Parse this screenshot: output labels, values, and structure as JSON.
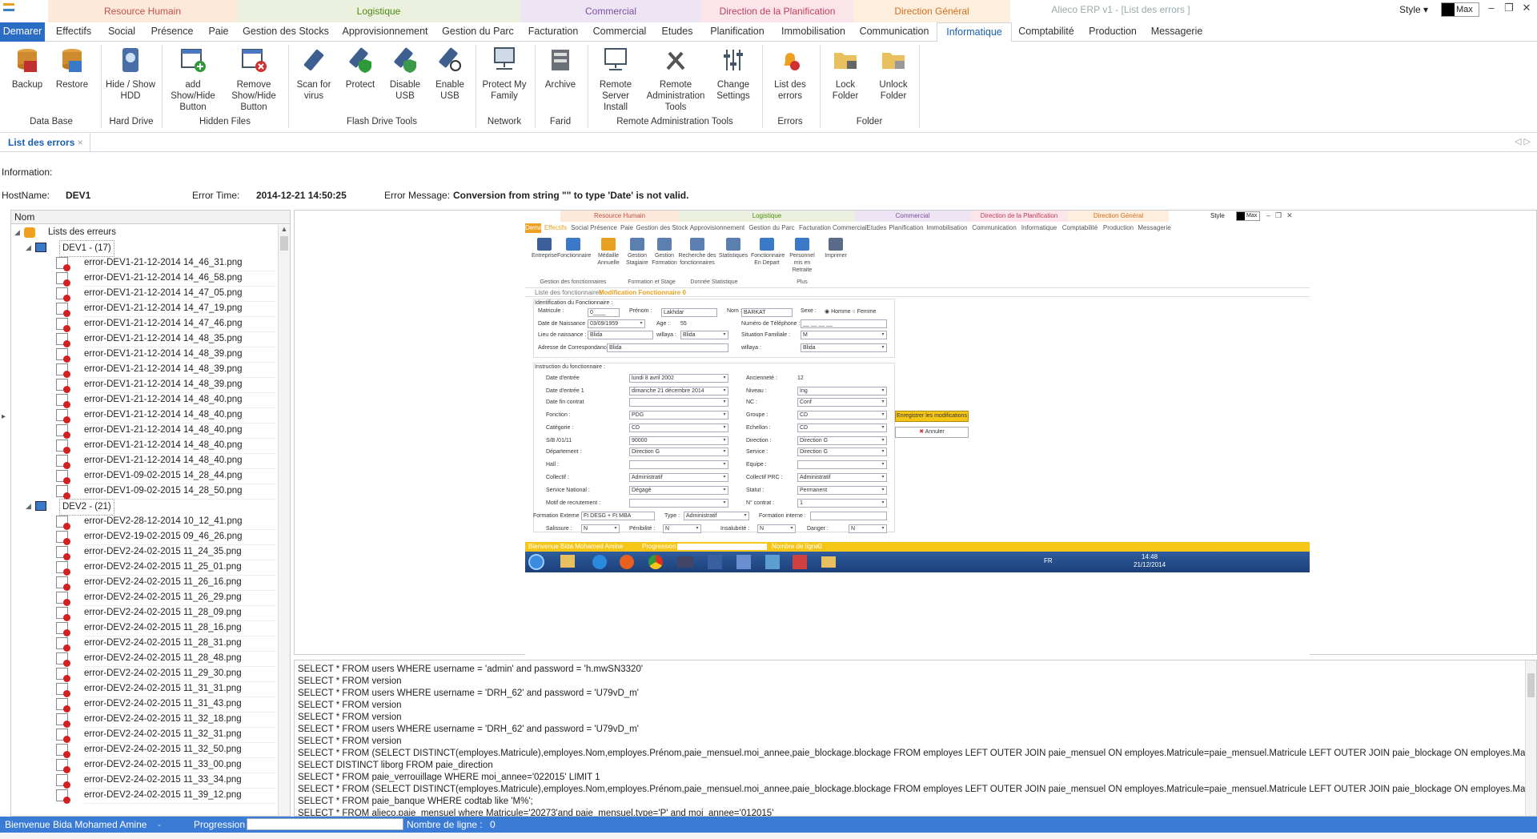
{
  "app": {
    "window_title": "Alieco ERP v1 - [List des errors ]",
    "style_label": "Style",
    "max_label": "Max"
  },
  "groups": [
    {
      "label": "Resource Humain",
      "color": "#fde9d9",
      "text": "#c0504d"
    },
    {
      "label": "Logistique",
      "color": "#ebf1de",
      "text": "#4f8a10"
    },
    {
      "label": "Commercial",
      "color": "#ede4f4",
      "text": "#7f4fa0"
    },
    {
      "label": "Direction de la Planification",
      "color": "#fbe4ea",
      "text": "#c0405a"
    },
    {
      "label": "Direction Général",
      "color": "#fdeede",
      "text": "#d07020"
    }
  ],
  "tabs": [
    "Demarer",
    "Effectifs",
    "Social",
    "Présence",
    "Paie",
    "Gestion des Stocks",
    "Approvisionnement",
    "Gestion du Parc",
    "Facturation",
    "Commercial",
    "Etudes",
    "Planification",
    "Immobilisation",
    "Communication",
    "Informatique",
    "Comptabilité",
    "Production",
    "Messagerie"
  ],
  "ribbon": {
    "buttons": [
      "Backup",
      "Restore",
      "Hide / Show HDD",
      "add Show/Hide Button",
      "Remove Show/Hide Button",
      "Scan for virus",
      "Protect",
      "Disable USB",
      "Enable USB",
      "Protect My Family",
      "Archive",
      "Remote Server Install",
      "Remote Administration Tools",
      "Change Settings",
      "List des errors",
      "Lock Folder",
      "Unlock Folder"
    ],
    "groups": [
      "Data Base",
      "Hard Drive",
      "Hidden Files",
      "Flash Drive Tools",
      "Network",
      "Farid",
      "Remote Administration Tools",
      "Errors",
      "Folder"
    ]
  },
  "doc_tab": "List des errors",
  "info": {
    "heading": "Information:",
    "host_label": "HostName:",
    "host": "DEV1",
    "time_label": "Error Time:",
    "time": "2014-12-21 14:50:25",
    "msg_label": "Error Message:",
    "msg": "Conversion from string \"\" to type 'Date' is not valid."
  },
  "tree": {
    "header": "Nom",
    "root": "Lists des erreurs",
    "dev1": {
      "label": "DEV1 - (17)",
      "files": [
        "error-DEV1-21-12-2014 14_46_31.png",
        "error-DEV1-21-12-2014 14_46_58.png",
        "error-DEV1-21-12-2014 14_47_05.png",
        "error-DEV1-21-12-2014 14_47_19.png",
        "error-DEV1-21-12-2014 14_47_46.png",
        "error-DEV1-21-12-2014 14_48_35.png",
        "error-DEV1-21-12-2014 14_48_39.png",
        "error-DEV1-21-12-2014 14_48_39.png",
        "error-DEV1-21-12-2014 14_48_39.png",
        "error-DEV1-21-12-2014 14_48_40.png",
        "error-DEV1-21-12-2014 14_48_40.png",
        "error-DEV1-21-12-2014 14_48_40.png",
        "error-DEV1-21-12-2014 14_48_40.png",
        "error-DEV1-21-12-2014 14_48_40.png",
        "error-DEV1-09-02-2015 14_28_44.png",
        "error-DEV1-09-02-2015 14_28_50.png"
      ]
    },
    "dev2": {
      "label": "DEV2 - (21)",
      "files": [
        "error-DEV2-28-12-2014 10_12_41.png",
        "error-DEV2-19-02-2015 09_46_26.png",
        "error-DEV2-24-02-2015 11_24_35.png",
        "error-DEV2-24-02-2015 11_25_01.png",
        "error-DEV2-24-02-2015 11_26_16.png",
        "error-DEV2-24-02-2015 11_26_29.png",
        "error-DEV2-24-02-2015 11_28_09.png",
        "error-DEV2-24-02-2015 11_28_16.png",
        "error-DEV2-24-02-2015 11_28_31.png",
        "error-DEV2-24-02-2015 11_28_48.png",
        "error-DEV2-24-02-2015 11_29_30.png",
        "error-DEV2-24-02-2015 11_31_31.png",
        "error-DEV2-24-02-2015 11_31_43.png",
        "error-DEV2-24-02-2015 11_32_18.png",
        "error-DEV2-24-02-2015 11_32_31.png",
        "error-DEV2-24-02-2015 11_32_50.png",
        "error-DEV2-24-02-2015 11_33_00.png",
        "error-DEV2-24-02-2015 11_33_34.png",
        "error-DEV2-24-02-2015 11_39_12.png"
      ]
    }
  },
  "preview": {
    "groups": [
      "Resource Humain",
      "Logistique",
      "Commercial",
      "Direction de la Planification",
      "Direction Général"
    ],
    "tabs": [
      "Demarer",
      "Effectifs",
      "Social",
      "Présence",
      "Paie",
      "Gestion des Stock",
      "Approvisionnement",
      "Gestion du Parc",
      "Facturation",
      "Commercial",
      "Etudes",
      "Planification",
      "Immobilisation",
      "Communication",
      "Informatique",
      "Comptabilité",
      "Production",
      "Messagerie"
    ],
    "ribbon": [
      "Entreprise",
      "Fonctionnaire",
      "Médaille Annuelle",
      "Gestion Stagiaire",
      "Gestion Formation",
      "Recherche des fonctionnaires",
      "Statistiques",
      "Fonctionnaire En Depart",
      "Personnel mis en Retraite",
      "Imprimer"
    ],
    "ribbon_groups": [
      "Gestion des fonctionnaires",
      "Formation et Stage",
      "Donnée Statistique",
      "Plus"
    ],
    "doctabs": [
      "Liste des fonctionnaires",
      "Modification Fonctionnaire 0"
    ],
    "sec1": "Identification du Fonctionnaire :",
    "sec2": "Instruction du fonctionnaire :",
    "fields": {
      "matricule": "Matricule :",
      "matricule_v": "0____",
      "prenom": "Prénom :",
      "prenom_v": "Lakhdar",
      "nom": "Nom :",
      "nom_v": "BARKAT",
      "sexe": "Sexe :",
      "homme": "Homme",
      "femme": "Femme",
      "dn": "Date de Naissance :",
      "dn_v": "03/09/1959",
      "age": "Age :",
      "age_v": "55",
      "tel": "Numéro de Téléphone :",
      "tel_v": "__ __ __ __",
      "ln": "Lieu de naissance :",
      "ln_v": "Blida",
      "wil": "willaya :",
      "wil_v": "Blida",
      "sf": "Situation Familiale :",
      "sf_v": "M",
      "adr": "Adresse de Correspondance :",
      "adr_v": "Blida",
      "wil2": "willaya :",
      "wil2_v": "Blida",
      "de": "Date d'entrée",
      "de_v": "lundi 8 avril 2002",
      "anc": "Ancienneté :",
      "anc_v": "12",
      "de1": "Date d'entrée 1",
      "de1_v": "dimanche 21 décembre 2014",
      "niv": "Niveau :",
      "niv_v": "Ing",
      "dfc": "Date fin contrat",
      "nc": "NC :",
      "nc_v": "Conf",
      "fct": "Fonction :",
      "fct_v": "PDG",
      "grp": "Groupe :",
      "grp_v": "CD",
      "cat": "Catégorie :",
      "cat_v": "CD",
      "ech": "Echellon :",
      "ech_v": "CD",
      "sb": "S/B /01/11",
      "sb_v": "90000",
      "dir": "Direction :",
      "dir_v": "Direction G",
      "dep": "Département :",
      "dep_v": "Direction G",
      "srv": "Service :",
      "srv_v": "Direction G",
      "hall": "Hall :",
      "eq": "Equipe :",
      "col": "Collectif :",
      "col_v": "Administratif",
      "colprc": "Collectif PRC :",
      "colprc_v": "Administratif",
      "sn": "Service National :",
      "sn_v": "Dégagé",
      "stat": "Statut :",
      "stat_v": "Permanent",
      "motif": "Motif de recrutement :",
      "ncontrat": "N° contrat :",
      "ncontrat_v": "1",
      "fext": "Formation Externe :",
      "fext_v": "Ft DESG + Ft MBA",
      "type": "Type :",
      "type_v": "Administratif",
      "fint": "Formation interne :",
      "sal": "Salissure :",
      "sal_v": "N",
      "pen": "Pénibilité :",
      "pen_v": "N",
      "ins": "Insalubrité :",
      "ins_v": "N",
      "dan": "Danger :",
      "dan_v": "N"
    },
    "save": "Enregistrer les modifications",
    "cancel": "Annuler",
    "status": "Bienvenue Bida Mohamed Amine",
    "progress": "Progression",
    "lines": "Nombre de ligne :",
    "lines_v": "0",
    "lang": "FR",
    "clock": "14:48",
    "date": "21/12/2014",
    "style": "Style",
    "max": "Max"
  },
  "sql": [
    "SELECT * FROM users WHERE username = 'admin' and password = 'h.mwSN3320'",
    "SELECT * FROM version",
    "SELECT * FROM users WHERE username = 'DRH_62' and password = 'U79vD_m'",
    "SELECT * FROM version",
    "SELECT * FROM version",
    "SELECT * FROM users WHERE username = 'DRH_62' and password = 'U79vD_m'",
    "SELECT * FROM version",
    "SELECT * FROM (SELECT DISTINCT(employes.Matricule),employes.Nom,employes.Prénom,paie_mensuel.moi_annee,paie_blockage.blockage FROM employes LEFT OUTER JOIN paie_mensuel ON employes.Matricule=paie_mensuel.Matricule  LEFT OUTER JOIN paie_blockage ON employes.Matricule=paie_blockage.Matric",
    "SELECT DISTINCT liborg FROM paie_direction",
    "SELECT * FROM paie_verrouillage WHERE moi_annee='022015' LIMIT 1",
    "SELECT * FROM (SELECT DISTINCT(employes.Matricule),employes.Nom,employes.Prénom,paie_mensuel.moi_annee,paie_blockage.blockage FROM employes LEFT OUTER JOIN paie_mensuel ON employes.Matricule=paie_mensuel.Matricule  LEFT OUTER JOIN paie_blockage ON employes.Matricule=paie_blockage.Matric",
    "SELECT * FROM paie_banque WHERE codtab like 'M%';",
    "SELECT * FROM alieco.paie_mensuel where Matricule='20273'and paie_mensuel.type='P' and moi_annee='012015'"
  ],
  "status": {
    "welcome": "Bienvenue Bida Mohamed Amine",
    "progress": "Progression",
    "lines": "Nombre de ligne :",
    "lines_v": "0"
  }
}
